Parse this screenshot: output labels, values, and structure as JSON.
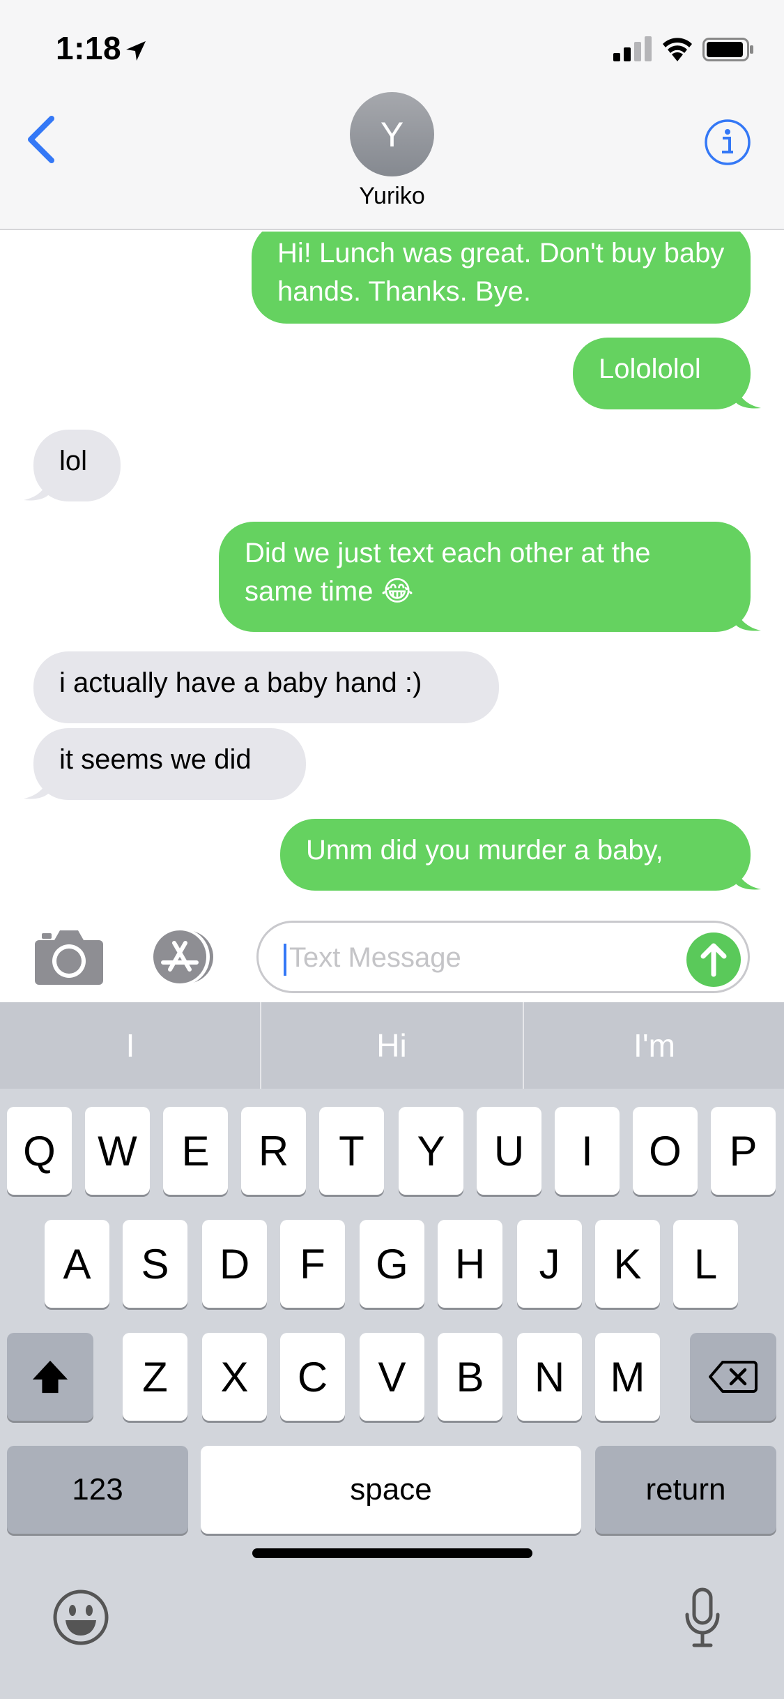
{
  "status_bar": {
    "time": "1:18"
  },
  "header": {
    "avatar_initial": "Y",
    "contact_name": "Yuriko"
  },
  "messages": [
    {
      "from": "me",
      "text": "Hi! Lunch was great. Don't buy baby hands. Thanks. Bye."
    },
    {
      "from": "me",
      "text": "Lolololol"
    },
    {
      "from": "them",
      "text": "lol"
    },
    {
      "from": "me",
      "text": "Did we just text each other at the same time 😂"
    },
    {
      "from": "them",
      "text": "i actually have a baby hand :)"
    },
    {
      "from": "them",
      "text": "it seems we did"
    },
    {
      "from": "me",
      "text": "Umm did you murder a baby,"
    }
  ],
  "input": {
    "placeholder": "Text Message"
  },
  "suggestions": [
    "I",
    "Hi",
    "I'm"
  ],
  "keyboard": {
    "row1": [
      "Q",
      "W",
      "E",
      "R",
      "T",
      "Y",
      "U",
      "I",
      "O",
      "P"
    ],
    "row2": [
      "A",
      "S",
      "D",
      "F",
      "G",
      "H",
      "J",
      "K",
      "L"
    ],
    "row3": [
      "Z",
      "X",
      "C",
      "V",
      "B",
      "N",
      "M"
    ],
    "numbers_label": "123",
    "space_label": "space",
    "return_label": "return"
  },
  "colors": {
    "sent_bubble": "#65d260",
    "received_bubble": "#e6e6eb",
    "accent": "#3478f6"
  },
  "icons": [
    "location-arrow-icon",
    "signal-icon",
    "wifi-icon",
    "battery-icon",
    "back-chevron-icon",
    "info-icon",
    "camera-icon",
    "app-store-icon",
    "send-arrow-icon",
    "shift-icon",
    "delete-icon",
    "emoji-icon",
    "microphone-icon"
  ]
}
